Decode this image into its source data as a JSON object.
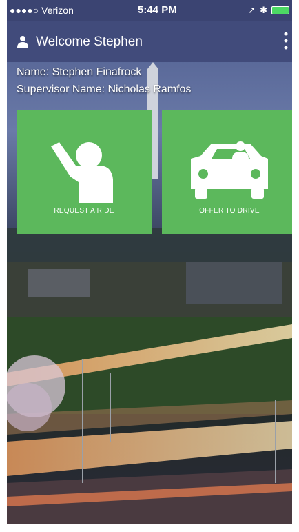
{
  "status_bar": {
    "carrier": "●●●●○ Verizon",
    "time": "5:44 PM",
    "right_icons": "location-icon bluetooth-icon battery-icon"
  },
  "app_bar": {
    "title": "Welcome Stephen",
    "user_icon": "user-icon",
    "menu_icon": "more-vertical-icon"
  },
  "info": {
    "name": "Name: Stephen Finafrock",
    "supervisor": "Supervisor Name: Nicholas Ramfos"
  },
  "tiles": [
    {
      "label": "REQUEST A RIDE",
      "icon": "waving-person-icon"
    },
    {
      "label": "OFFER TO DRIVE",
      "icon": "car-with-driver-icon"
    }
  ],
  "colors": {
    "app_bar": "#414b7b",
    "status_bar": "#3b4472",
    "tile": "#5cb85c",
    "text": "#ffffff"
  }
}
